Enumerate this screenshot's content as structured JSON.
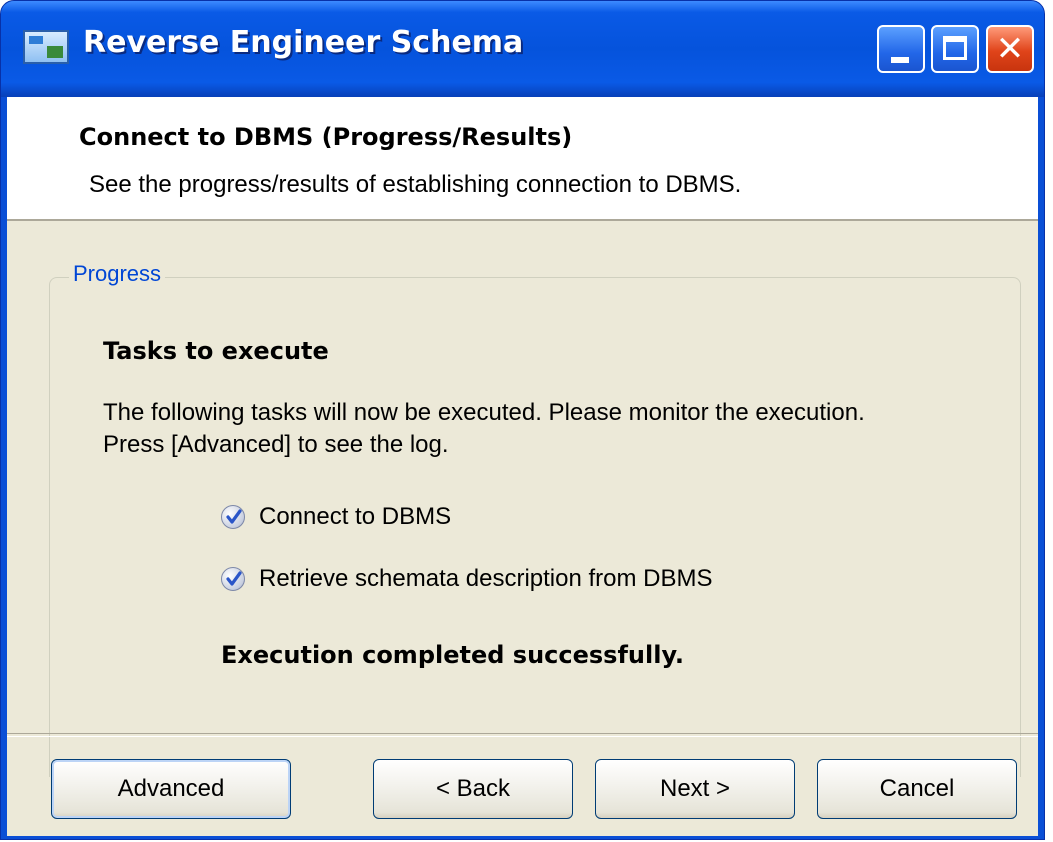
{
  "window": {
    "title": "Reverse Engineer Schema"
  },
  "header": {
    "title": "Connect to DBMS (Progress/Results)",
    "description": "See the progress/results of establishing connection to DBMS."
  },
  "progress": {
    "group_label": "Progress",
    "heading": "Tasks to execute",
    "instructions": [
      "The following tasks will now be executed. Please monitor the execution.",
      "Press [Advanced] to see the log."
    ],
    "tasks": [
      {
        "label": "Connect to DBMS",
        "status": "done",
        "icon": "checkmark-icon"
      },
      {
        "label": "Retrieve schemata description from DBMS",
        "status": "done",
        "icon": "checkmark-icon"
      }
    ],
    "result": "Execution completed successfully."
  },
  "buttons": {
    "advanced": "Advanced",
    "back": "< Back",
    "next": "Next >",
    "cancel": "Cancel"
  },
  "colors": {
    "titlebar": "#0a5ae6",
    "client_bg": "#ece9d8",
    "group_label": "#0046d5",
    "close_button": "#e0441a"
  }
}
